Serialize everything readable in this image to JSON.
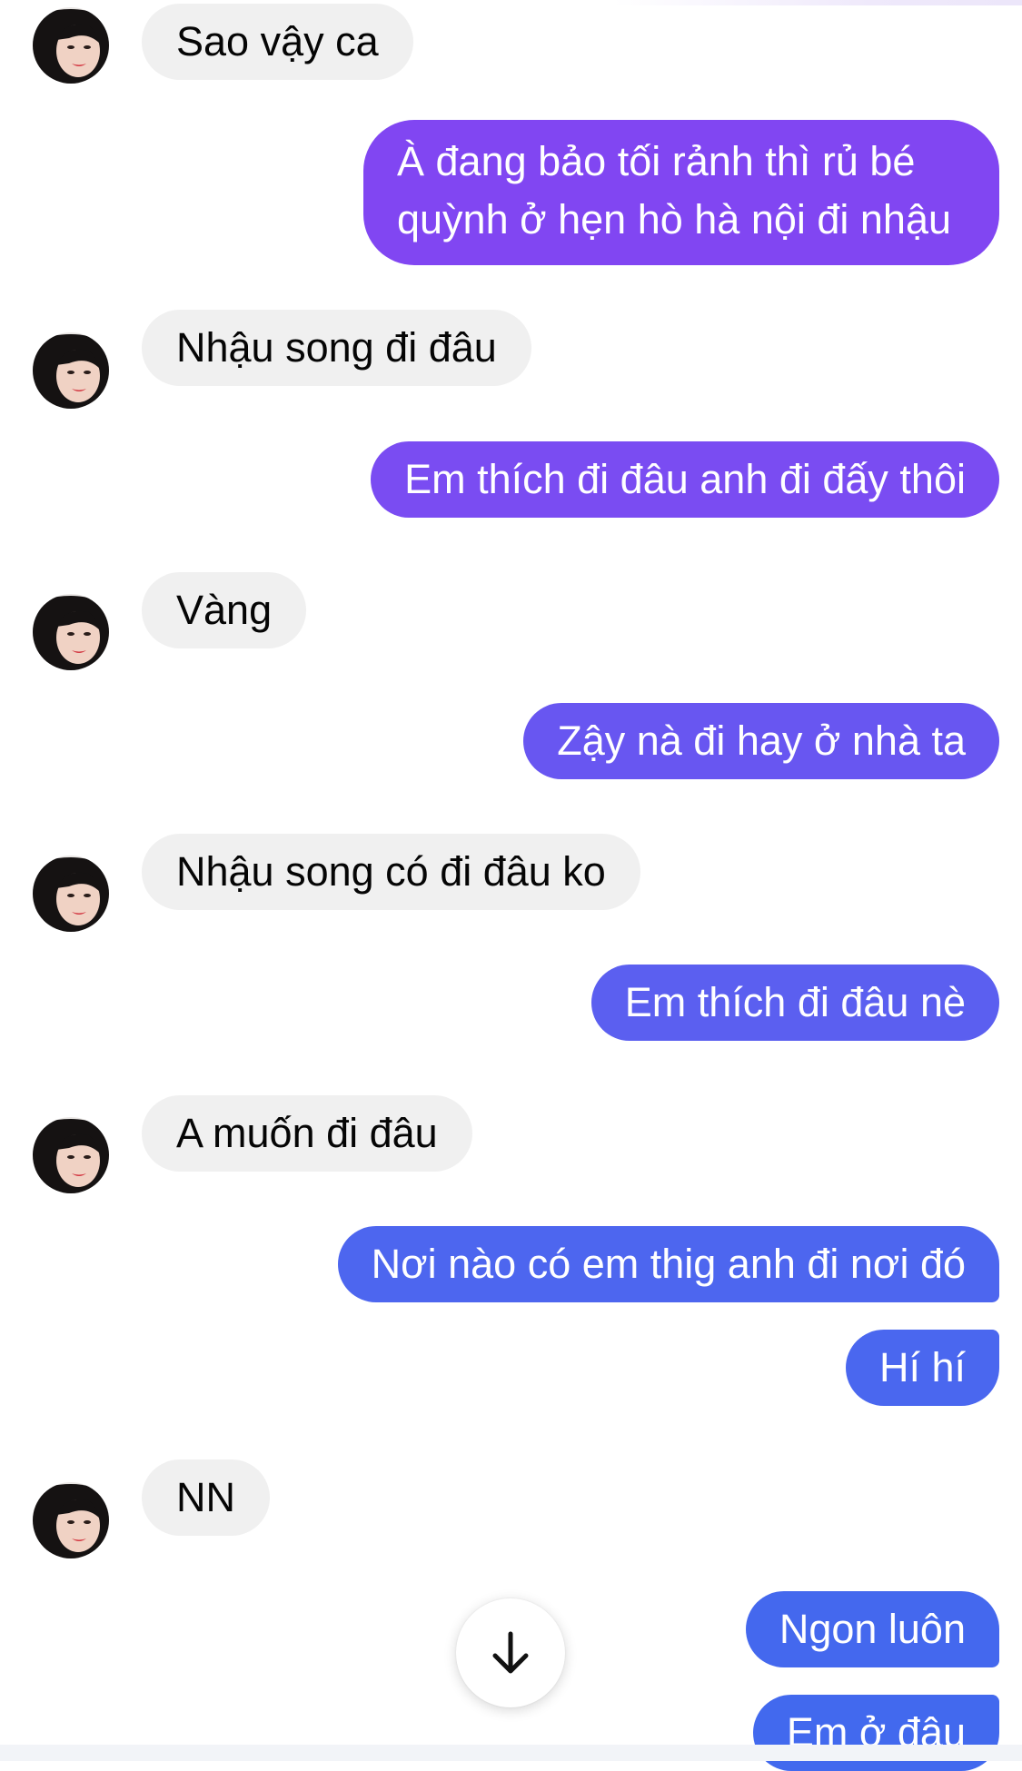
{
  "conversation": {
    "messages": [
      {
        "side": "in",
        "text": "Sao vậy ca"
      },
      {
        "side": "out",
        "lines": [
          "À đang bảo tối rảnh thì rủ bé",
          "quỳnh ở hẹn hò hà nội đi nhậu"
        ],
        "color": "#8146f2"
      },
      {
        "side": "in",
        "text": "Nhậu song đi đâu"
      },
      {
        "side": "out",
        "text": "Em thích đi đâu anh đi đấy thôi",
        "color": "#7a4cf2"
      },
      {
        "side": "in",
        "text": "Vàng"
      },
      {
        "side": "out",
        "text": "Zậy nà đi hay ở nhà ta",
        "color": "#6856f1"
      },
      {
        "side": "in",
        "text": "Nhậu song có đi đâu ko"
      },
      {
        "side": "out",
        "text": "Em thích đi đâu nè",
        "color": "#5b5ff0"
      },
      {
        "side": "in",
        "text": "A muốn đi đâu"
      },
      {
        "side": "out",
        "text": "Nơi nào có em thig anh đi nơi đó",
        "color": "#4d66ef"
      },
      {
        "side": "out",
        "text": "Hí hí",
        "color": "#4a67ef"
      },
      {
        "side": "in",
        "text": "NN"
      },
      {
        "side": "out",
        "text": "Ngon luôn",
        "color": "#4468ee"
      },
      {
        "side": "out",
        "text": "Em ở đâu",
        "color": "#4269ee"
      }
    ]
  },
  "scroll_button": {
    "icon": "arrow-down-icon"
  }
}
